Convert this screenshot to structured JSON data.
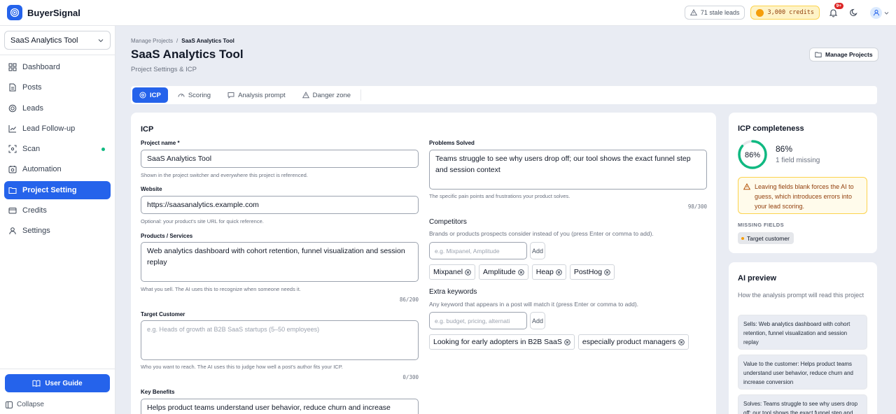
{
  "app": {
    "brand": "BuyerSignal"
  },
  "topbar": {
    "stale_leads": "71 stale leads",
    "credits": "3,000 credits",
    "notifications_badge": "9+"
  },
  "sidebar": {
    "project_select": "SaaS Analytics Tool",
    "items": [
      {
        "label": "Dashboard",
        "icon": "dashboard-icon"
      },
      {
        "label": "Posts",
        "icon": "posts-icon"
      },
      {
        "label": "Leads",
        "icon": "leads-icon"
      },
      {
        "label": "Lead Follow-up",
        "icon": "chart-icon"
      },
      {
        "label": "Scan",
        "icon": "scan-icon"
      },
      {
        "label": "Automation",
        "icon": "automation-icon"
      },
      {
        "label": "Project Setting",
        "icon": "settings-folder-icon"
      },
      {
        "label": "Credits",
        "icon": "credits-icon"
      },
      {
        "label": "Settings",
        "icon": "user-icon"
      }
    ],
    "user_guide": "User Guide",
    "collapse": "Collapse"
  },
  "breadcrumb": {
    "parent": "Manage Projects",
    "separator": "/",
    "current": "SaaS Analytics Tool"
  },
  "page": {
    "title": "SaaS Analytics Tool",
    "subtitle": "Project Settings & ICP",
    "manage_button": "Manage Projects"
  },
  "tabs": [
    "ICP",
    "Scoring",
    "Analysis prompt",
    "Danger zone"
  ],
  "icp": {
    "heading": "ICP",
    "project_name": {
      "label": "Project name *",
      "value": "SaaS Analytics Tool",
      "help": "Shown in the project switcher and everywhere this project is referenced."
    },
    "website": {
      "label": "Website",
      "value": "https://saasanalytics.example.com",
      "help": "Optional: your product's site URL for quick reference."
    },
    "products": {
      "label": "Products / Services",
      "value": "Web analytics dashboard with cohort retention, funnel visualization and session replay",
      "help": "What you sell. The AI uses this to recognize when someone needs it.",
      "counter": "86/200"
    },
    "target_customer": {
      "label": "Target Customer",
      "placeholder": "e.g. Heads of growth at B2B SaaS startups (5–50 employees)",
      "help": "Who you want to reach. The AI uses this to judge how well a post's author fits your ICP.",
      "counter": "0/300"
    },
    "key_benefits": {
      "label": "Key Benefits",
      "value": "Helps product teams understand user behavior, reduce churn and increase"
    },
    "problems_solved": {
      "label": "Problems Solved",
      "value": "Teams struggle to see why users drop off; our tool shows the exact funnel step and session context",
      "help": "The specific pain points and frustrations your product solves.",
      "counter": "98/300"
    },
    "competitors": {
      "label": "Competitors",
      "help": "Brands or products prospects consider instead of you (press Enter or comma to add).",
      "placeholder": "e.g. Mixpanel, Amplitude",
      "add": "Add",
      "chips": [
        "Mixpanel",
        "Amplitude",
        "Heap",
        "PostHog"
      ]
    },
    "keywords": {
      "label": "Extra keywords",
      "help": "Any keyword that appears in a post will match it (press Enter or comma to add).",
      "placeholder": "e.g. budget, pricing, alternati",
      "add": "Add",
      "chips": [
        "Looking for early adopters in B2B SaaS",
        "especially product managers"
      ]
    }
  },
  "completeness": {
    "title": "ICP completeness",
    "percent": 86,
    "percent_label": "86%",
    "missing_count": "1 field missing",
    "warning": "Leaving fields blank forces the AI to guess, which introduces errors into your lead scoring.",
    "missing_fields_label": "MISSING FIELDS",
    "missing_fields": [
      "Target customer"
    ]
  },
  "preview": {
    "title": "AI preview",
    "subtitle": "How the analysis prompt will read this project",
    "items": [
      "Sells: Web analytics dashboard with cohort retention, funnel visualization and session replay",
      "Value to the customer: Helps product teams understand user behavior, reduce churn and increase conversion",
      "Solves: Teams struggle to see why users drop off; our tool shows the exact funnel step and session context"
    ]
  },
  "colors": {
    "accent": "#2563eb",
    "success": "#10b981",
    "warning": "#f59e0b",
    "danger": "#dc2626"
  }
}
